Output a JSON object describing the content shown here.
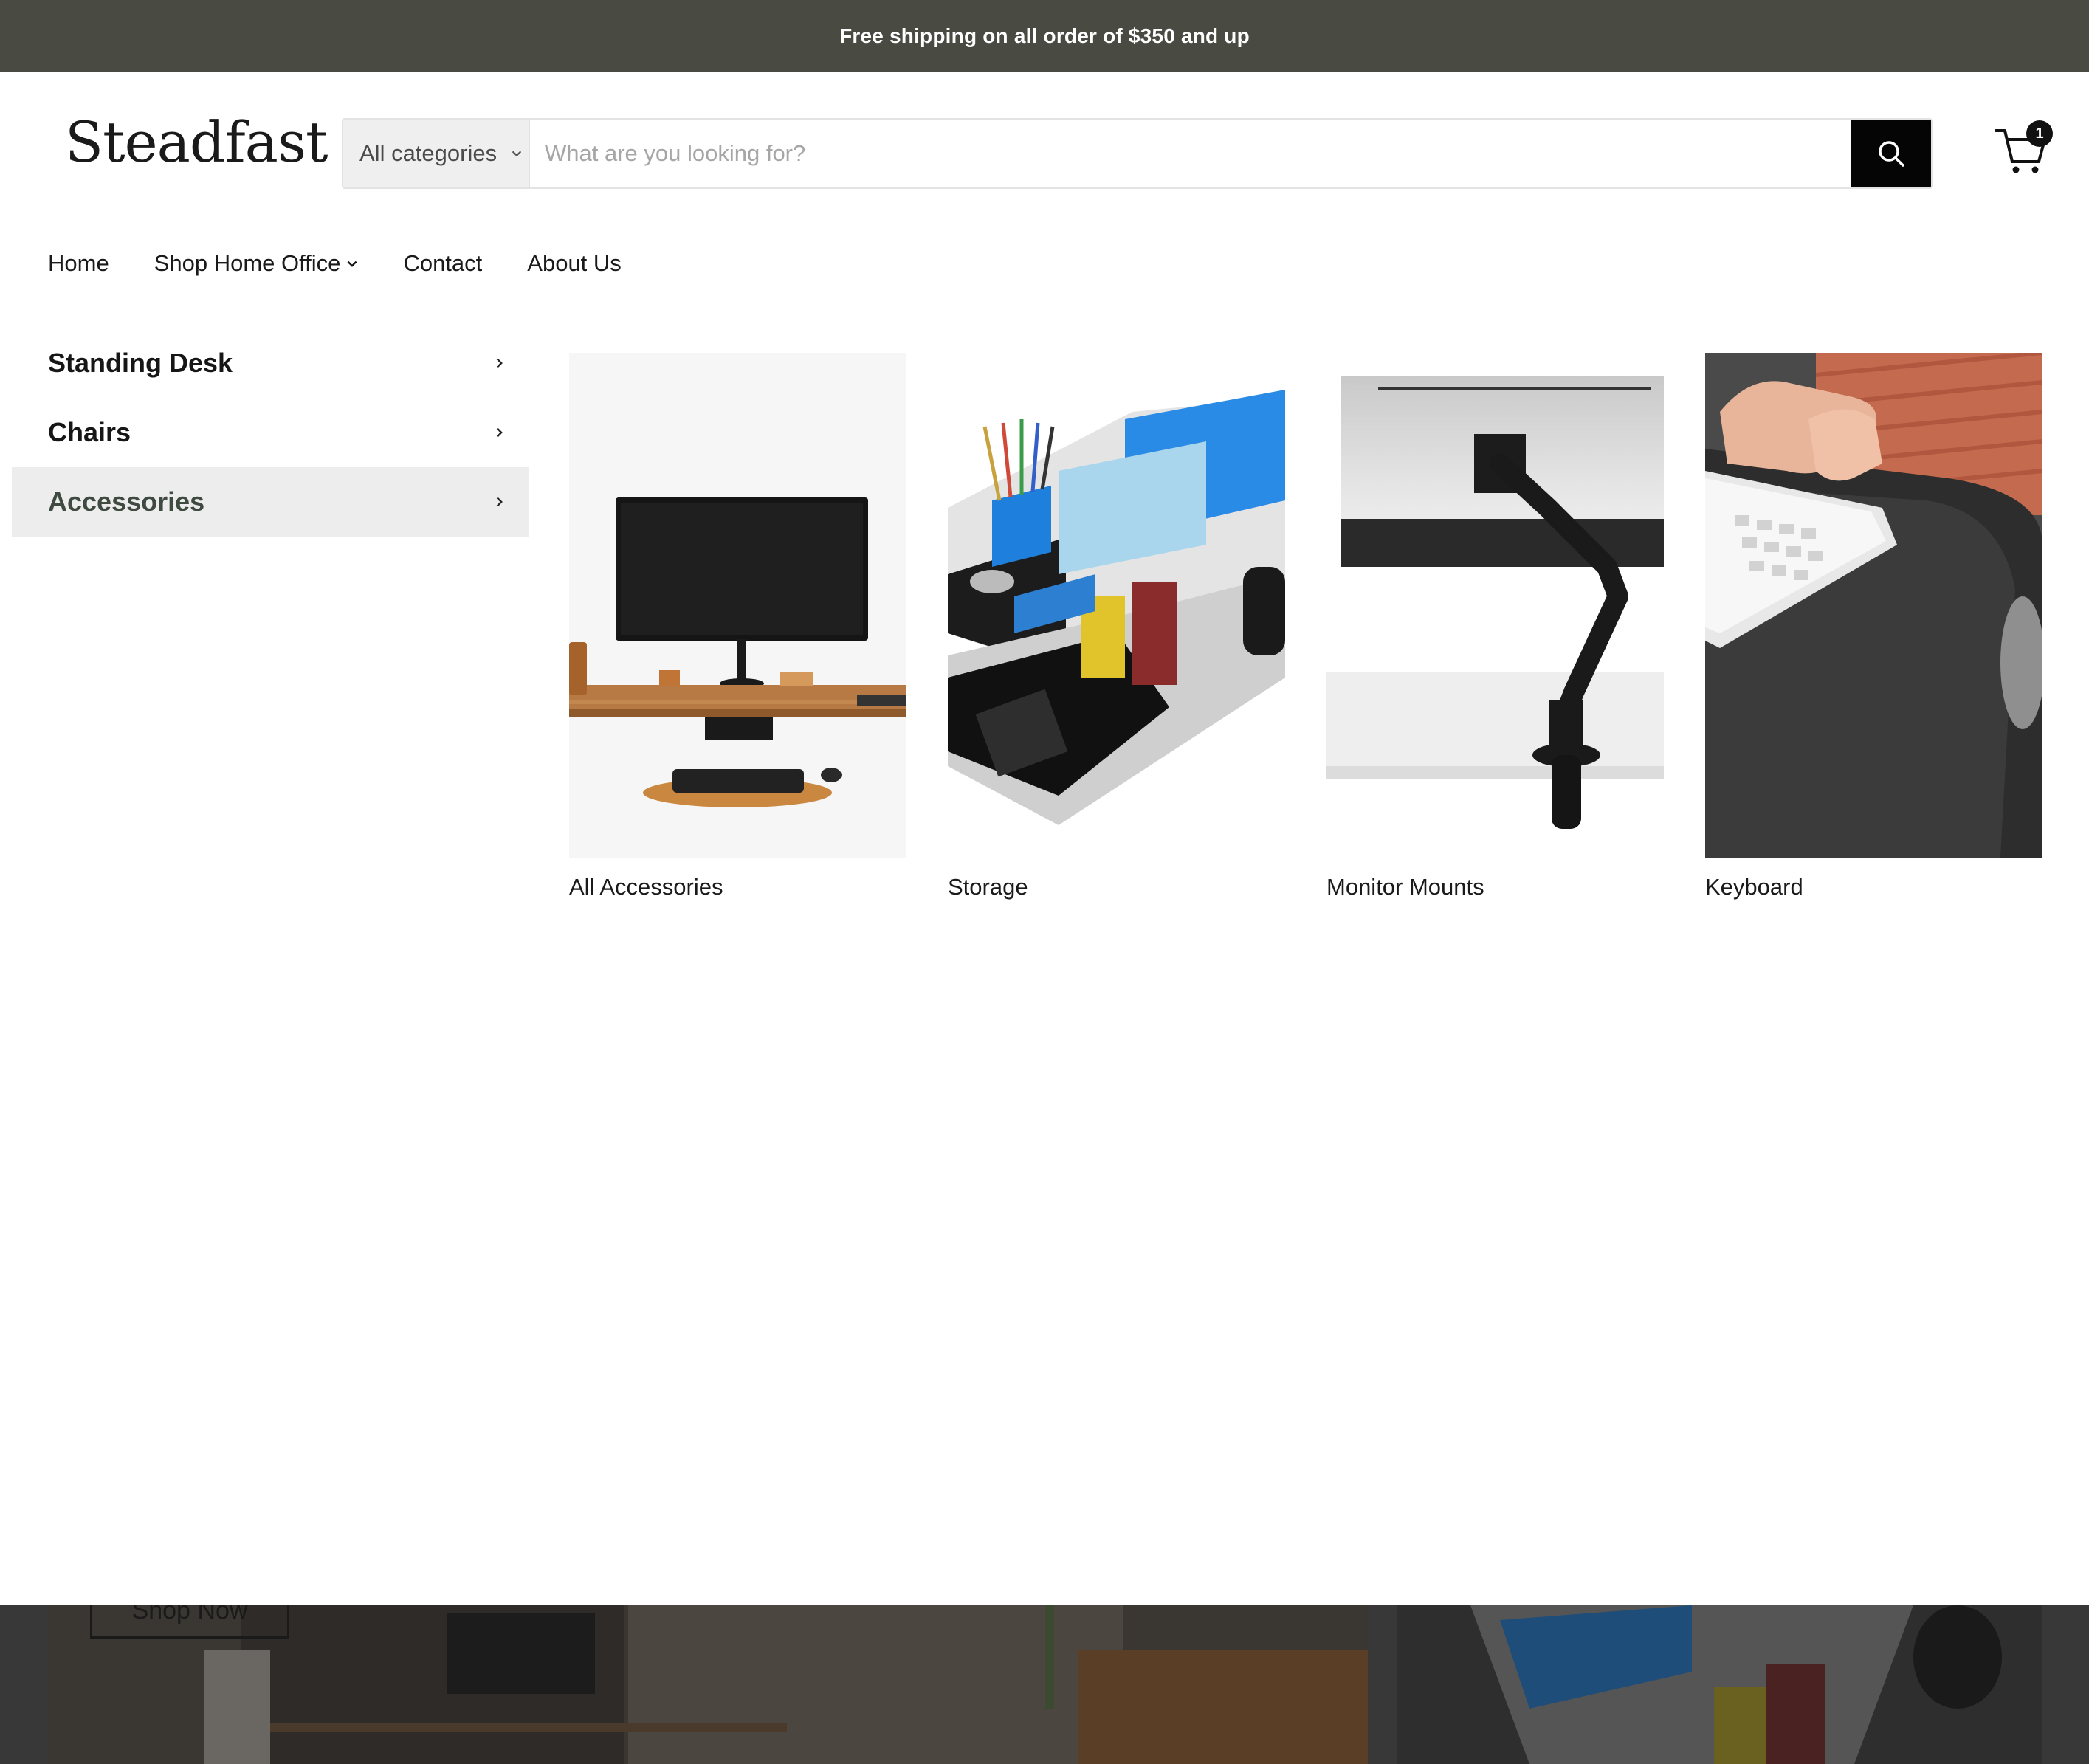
{
  "announcement": {
    "text": "Free shipping on all order of $350 and up"
  },
  "header": {
    "logo": "Steadfast",
    "search": {
      "category": "All categories",
      "placeholder": "What are you looking for?"
    },
    "cart_count": "1"
  },
  "nav": {
    "items": [
      "Home",
      "Shop Home Office",
      "Contact",
      "About Us"
    ]
  },
  "mega_menu": {
    "categories": [
      {
        "label": "Standing Desk",
        "active": false
      },
      {
        "label": "Chairs",
        "active": false
      },
      {
        "label": "Accessories",
        "active": true
      }
    ],
    "tiles": [
      {
        "label": "All Accessories",
        "image": "desk-with-monitor"
      },
      {
        "label": "Storage",
        "image": "desk-organizer"
      },
      {
        "label": "Monitor Mounts",
        "image": "monitor-arm"
      },
      {
        "label": "Keyboard",
        "image": "keyboard-tray"
      }
    ]
  },
  "background_page": {
    "button_label": "Shop Now"
  },
  "colors": {
    "announcement_bg": "#494b43",
    "active_category_bg": "#ededed",
    "search_button": "#050505"
  }
}
